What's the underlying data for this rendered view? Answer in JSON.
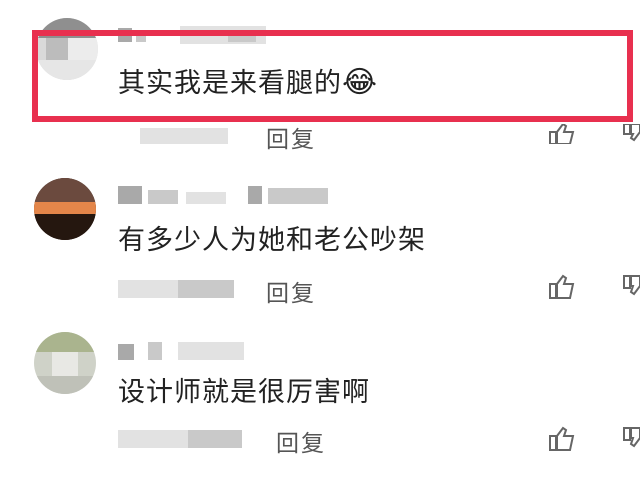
{
  "comments": [
    {
      "text": "其实我是来看腿的",
      "emoji": "😂",
      "reply_label": "回复"
    },
    {
      "text": "有多少人为她和老公吵架",
      "reply_label": "回复"
    },
    {
      "text": "设计师就是很厉害啊",
      "reply_label": "回复"
    }
  ],
  "icons": [
    "thumbs-up-icon",
    "thumbs-down-icon"
  ],
  "colors": {
    "highlight": "#e8304f",
    "text": "#222222",
    "reply": "#555555"
  }
}
